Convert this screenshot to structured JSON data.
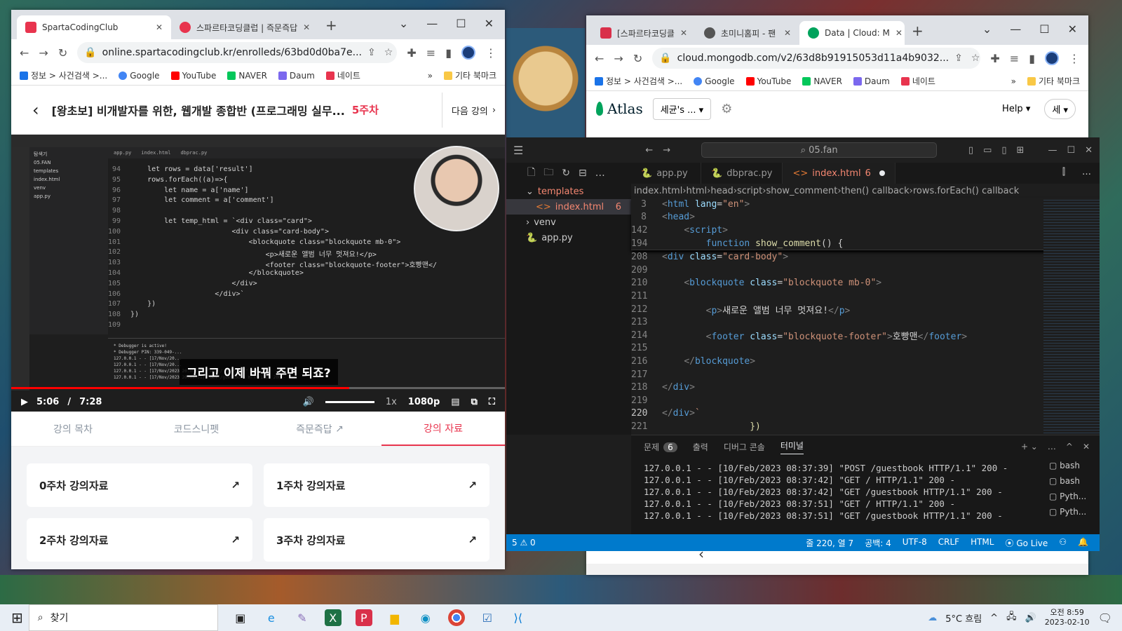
{
  "left_browser": {
    "tabs": [
      {
        "title": "SpartaCodingClub",
        "favicon_color": "#e8344e"
      },
      {
        "title": "스파르타코딩클럽 | 즉문즉답",
        "favicon_color": "#e8344e"
      }
    ],
    "url": "online.spartacodingclub.kr/enrolleds/63bd0d0ba7e...",
    "bookmarks": [
      "정보 > 사건검색 >...",
      "Google",
      "YouTube",
      "NAVER",
      "Daum",
      "네이트",
      "기타 북마크"
    ],
    "course": {
      "title": "[왕초보] 비개발자를 위한, 웹개발 종합반 (프로그래밍 실무...",
      "week": "5주차",
      "next_label": "다음 강의"
    },
    "video": {
      "caption": "그리고 이제 바꿔 주면 되죠?",
      "current_time": "5:06",
      "separator": "/",
      "duration": "7:28",
      "progress": 0.684,
      "speed": "1x",
      "quality": "1080p",
      "editor_tabs": [
        "app.py",
        "index.html",
        "dbprac.py"
      ],
      "explorer": [
        "탐색기",
        "05.FAN",
        "templates",
        "index.html",
        "venv",
        "app.py"
      ],
      "code_lines": [
        {
          "n": "94",
          "text": "    let rows = data['result']"
        },
        {
          "n": "95",
          "text": "    rows.forEach((a)=>{"
        },
        {
          "n": "96",
          "text": "        let name = a['name']"
        },
        {
          "n": "97",
          "text": "        let comment = a['comment']"
        },
        {
          "n": "98",
          "text": ""
        },
        {
          "n": "99",
          "text": "        let temp_html = `<div class=\"card\">"
        },
        {
          "n": "100",
          "text": "                        <div class=\"card-body\">"
        },
        {
          "n": "101",
          "text": "                            <blockquote class=\"blockquote mb-0\">"
        },
        {
          "n": "102",
          "text": "                                <p>새로운 앨범 너무 멋져요!</p>"
        },
        {
          "n": "103",
          "text": "                                <footer class=\"blockquote-footer\">호빵맨</"
        },
        {
          "n": "104",
          "text": "                            </blockquote>"
        },
        {
          "n": "105",
          "text": "                        </div>"
        },
        {
          "n": "106",
          "text": "                    </div>`"
        },
        {
          "n": "107",
          "text": "    })"
        },
        {
          "n": "108",
          "text": "})"
        },
        {
          "n": "109",
          "text": ""
        }
      ],
      "terminal_lines": [
        "* Debugger is active!",
        "* Debugger PIN: 339-049-...",
        "127.0.0.1 - - [17/Nov/20...",
        "127.0.0.1 - - [17/Nov/20...",
        "127.0.0.1 - - [17/Nov/2023 20:05:51] \"GET / HTTP/1.1\" 200 -",
        "127.0.0.1 - - [17/Nov/2023 20:05:51] \"GET /guestbook HTTP/1.1\" 200 -"
      ]
    },
    "content_tabs": [
      {
        "label": "강의 목차",
        "active": false
      },
      {
        "label": "코드스니펫",
        "active": false
      },
      {
        "label": "즉문즉답",
        "active": false
      },
      {
        "label": "강의 자료",
        "active": true
      }
    ],
    "cards": [
      "0주차 강의자료",
      "1주차 강의자료",
      "2주차 강의자료",
      "3주차 강의자료"
    ]
  },
  "right_browser": {
    "tabs": [
      {
        "title": "[스파르타코딩클",
        "favicon_color": "#d9304a"
      },
      {
        "title": "초미니홈피 - 팬",
        "favicon_color": "#555555"
      },
      {
        "title": "Data | Cloud: M",
        "favicon_color": "#00a35c"
      }
    ],
    "url": "cloud.mongodb.com/v2/63d8b91915053d11a4b9032...",
    "bookmarks": [
      "정보 > 사건검색 >...",
      "Google",
      "YouTube",
      "NAVER",
      "Daum",
      "네이트",
      "기타 북마크"
    ],
    "atlas": {
      "logo": "Atlas",
      "org": "세균's ...",
      "help": "Help",
      "user": "세"
    }
  },
  "vscode": {
    "search": "05.fan",
    "explorer": [
      {
        "label": "templates",
        "type": "folder-open",
        "indent": 0
      },
      {
        "label": "index.html",
        "type": "html",
        "indent": 1,
        "badge": "6",
        "selected": true
      },
      {
        "label": "venv",
        "type": "folder",
        "indent": 0
      },
      {
        "label": "app.py",
        "type": "py",
        "indent": 0
      }
    ],
    "tabs": [
      {
        "label": "app.py",
        "active": false
      },
      {
        "label": "dbprac.py",
        "active": false
      },
      {
        "label": "index.html",
        "badge": "6",
        "active": true
      }
    ],
    "breadcrumb": [
      "index.html",
      "html",
      "head",
      "script",
      "show_comment",
      "then() callback",
      "rows.forEach() callback"
    ],
    "sticky_lines": [
      {
        "n": "3",
        "html": "<span class='tg'>&lt;</span><span class='tn'>html</span> <span class='at'>lang</span>=<span class='sv'>\"en\"</span><span class='tg'>&gt;</span>"
      },
      {
        "n": "8",
        "html": "<span class='tg'>&lt;</span><span class='tn'>head</span><span class='tg'>&gt;</span>"
      },
      {
        "n": "142",
        "html": "    <span class='tg'>&lt;</span><span class='tn'>script</span><span class='tg'>&gt;</span>"
      },
      {
        "n": "194",
        "html": "        <span class='kw'>function</span> <span class='fn'>show_comment</span>() {"
      }
    ],
    "lines": [
      {
        "n": "208",
        "html": "<span class='tg'>&lt;</span><span class='tn'>div</span> <span class='at'>class</span>=<span class='sv'>\"card-body\"</span><span class='tg'>&gt;</span>"
      },
      {
        "n": "209",
        "html": ""
      },
      {
        "n": "210",
        "html": "    <span class='tg'>&lt;</span><span class='tn'>blockquote</span> <span class='at'>class</span>=<span class='sv'>\"blockquote mb-0\"</span><span class='tg'>&gt;</span>"
      },
      {
        "n": "211",
        "html": ""
      },
      {
        "n": "212",
        "html": "        <span class='tg'>&lt;</span><span class='tn'>p</span><span class='tg'>&gt;</span><span class='tx'>새로운 앨범 너무 멋져요!</span><span class='tg'>&lt;/</span><span class='tn'>p</span><span class='tg'>&gt;</span>"
      },
      {
        "n": "213",
        "html": ""
      },
      {
        "n": "214",
        "html": "        <span class='tg'>&lt;</span><span class='tn'>footer</span> <span class='at'>class</span>=<span class='sv'>\"blockquote-footer\"</span><span class='tg'>&gt;</span><span class='tx'>호빵맨</span><span class='tg'>&lt;/</span><span class='tn'>footer</span><span class='tg'>&gt;</span>"
      },
      {
        "n": "215",
        "html": ""
      },
      {
        "n": "216",
        "html": "    <span class='tg'>&lt;/</span><span class='tn'>blockquote</span><span class='tg'>&gt;</span>"
      },
      {
        "n": "217",
        "html": ""
      },
      {
        "n": "218",
        "html": "<span class='tg'>&lt;/</span><span class='tn'>div</span><span class='tg'>&gt;</span>"
      },
      {
        "n": "219",
        "html": ""
      },
      {
        "n": "220",
        "html": "<span class='tg'>&lt;/</span><span class='tn'>div</span><span class='tg'>&gt;</span><span class='sv'>`</span>",
        "current": true
      },
      {
        "n": "221",
        "html": "                <span class='fn'>})</span>"
      }
    ],
    "panel_tabs": [
      {
        "label": "문제",
        "count": "6"
      },
      {
        "label": "출력"
      },
      {
        "label": "디버그 콘솔"
      },
      {
        "label": "터미널",
        "active": true
      }
    ],
    "terminal": [
      "127.0.0.1 - - [10/Feb/2023 08:37:39] \"POST /guestbook HTTP/1.1\" 200 -",
      "127.0.0.1 - - [10/Feb/2023 08:37:42] \"GET / HTTP/1.1\" 200 -",
      "127.0.0.1 - - [10/Feb/2023 08:37:42] \"GET /guestbook HTTP/1.1\" 200 -",
      "127.0.0.1 - - [10/Feb/2023 08:37:51] \"GET / HTTP/1.1\" 200 -",
      "127.0.0.1 - - [10/Feb/2023 08:37:51] \"GET /guestbook HTTP/1.1\" 200 -"
    ],
    "shells": [
      "bash",
      "bash",
      "Pyth...",
      "Pyth..."
    ],
    "status": {
      "problems": "5 ⚠ 0",
      "position": "줄 220, 열 7",
      "spaces": "공백: 4",
      "encoding": "UTF-8",
      "eol": "CRLF",
      "language": "HTML",
      "golive": "Go Live"
    }
  },
  "taskbar": {
    "search_placeholder": "찾기",
    "weather": "5°C  흐림",
    "time": "오전 8:59",
    "date": "2023-02-10"
  }
}
